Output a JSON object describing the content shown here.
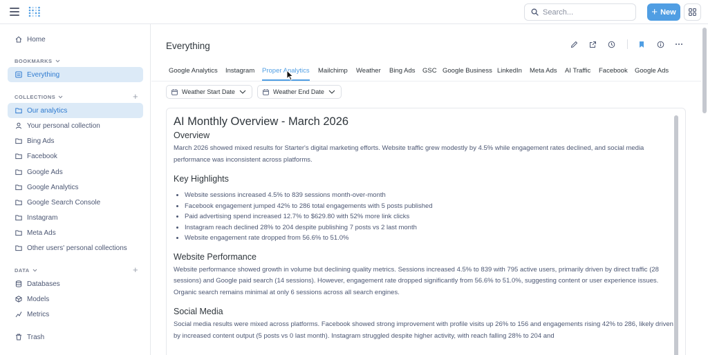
{
  "topbar": {
    "search_placeholder": "Search...",
    "new_label": "New"
  },
  "sidebar": {
    "home": "Home",
    "bookmarks_heading": "BOOKMARKS",
    "bookmark_items": [
      "Everything"
    ],
    "collections_heading": "COLLECTIONS",
    "collections": [
      "Our analytics",
      "Your personal collection",
      "Bing Ads",
      "Facebook",
      "Google Ads",
      "Google Analytics",
      "Google Search Console",
      "Instagram",
      "Meta Ads",
      "Other users' personal collections"
    ],
    "data_heading": "DATA",
    "data_items": [
      "Databases",
      "Models",
      "Metrics"
    ],
    "trash": "Trash"
  },
  "page": {
    "title": "Everything",
    "tabs": [
      "Google Analytics",
      "Instagram",
      "Proper Analytics",
      "Mailchimp",
      "Weather",
      "Bing Ads",
      "GSC",
      "Google Business",
      "LinkedIn",
      "Meta Ads",
      "AI Traffic",
      "Facebook",
      "Google Ads"
    ],
    "active_tab": "Proper Analytics",
    "filters": [
      "Weather Start Date",
      "Weather End Date"
    ]
  },
  "report": {
    "title": "AI Monthly Overview - March 2026",
    "overview_heading": "Overview",
    "overview_text": "March 2026 showed mixed results for Starter's digital marketing efforts. Website traffic grew modestly by 4.5% while engagement rates declined, and social media performance was inconsistent across platforms.",
    "highlights_heading": "Key Highlights",
    "highlights": [
      "Website sessions increased 4.5% to 839 sessions month-over-month",
      "Facebook engagement jumped 42% to 286 total engagements with 5 posts published",
      "Paid advertising spend increased 12.7% to $629.80 with 52% more link clicks",
      "Instagram reach declined 28% to 204 despite publishing 7 posts vs 2 last month",
      "Website engagement rate dropped from 56.6% to 51.0%"
    ],
    "website_heading": "Website Performance",
    "website_text": "Website performance showed growth in volume but declining quality metrics. Sessions increased 4.5% to 839 with 795 active users, primarily driven by direct traffic (28 sessions) and Google paid search (14 sessions). However, engagement rate dropped significantly from 56.6% to 51.0%, suggesting content or user experience issues. Organic search remains minimal at only 6 sessions across all search engines.",
    "social_heading": "Social Media",
    "social_text": "Social media results were mixed across platforms. Facebook showed strong improvement with profile visits up 26% to 156 and engagements rising 42% to 286, likely driven by increased content output (5 posts vs 0 last month). Instagram struggled despite higher activity, with reach falling 28% to 204 and"
  },
  "colors": {
    "accent": "#509ee3",
    "active_bg": "#dceaf7",
    "text": "#4c5773",
    "heading": "#2e353b"
  }
}
